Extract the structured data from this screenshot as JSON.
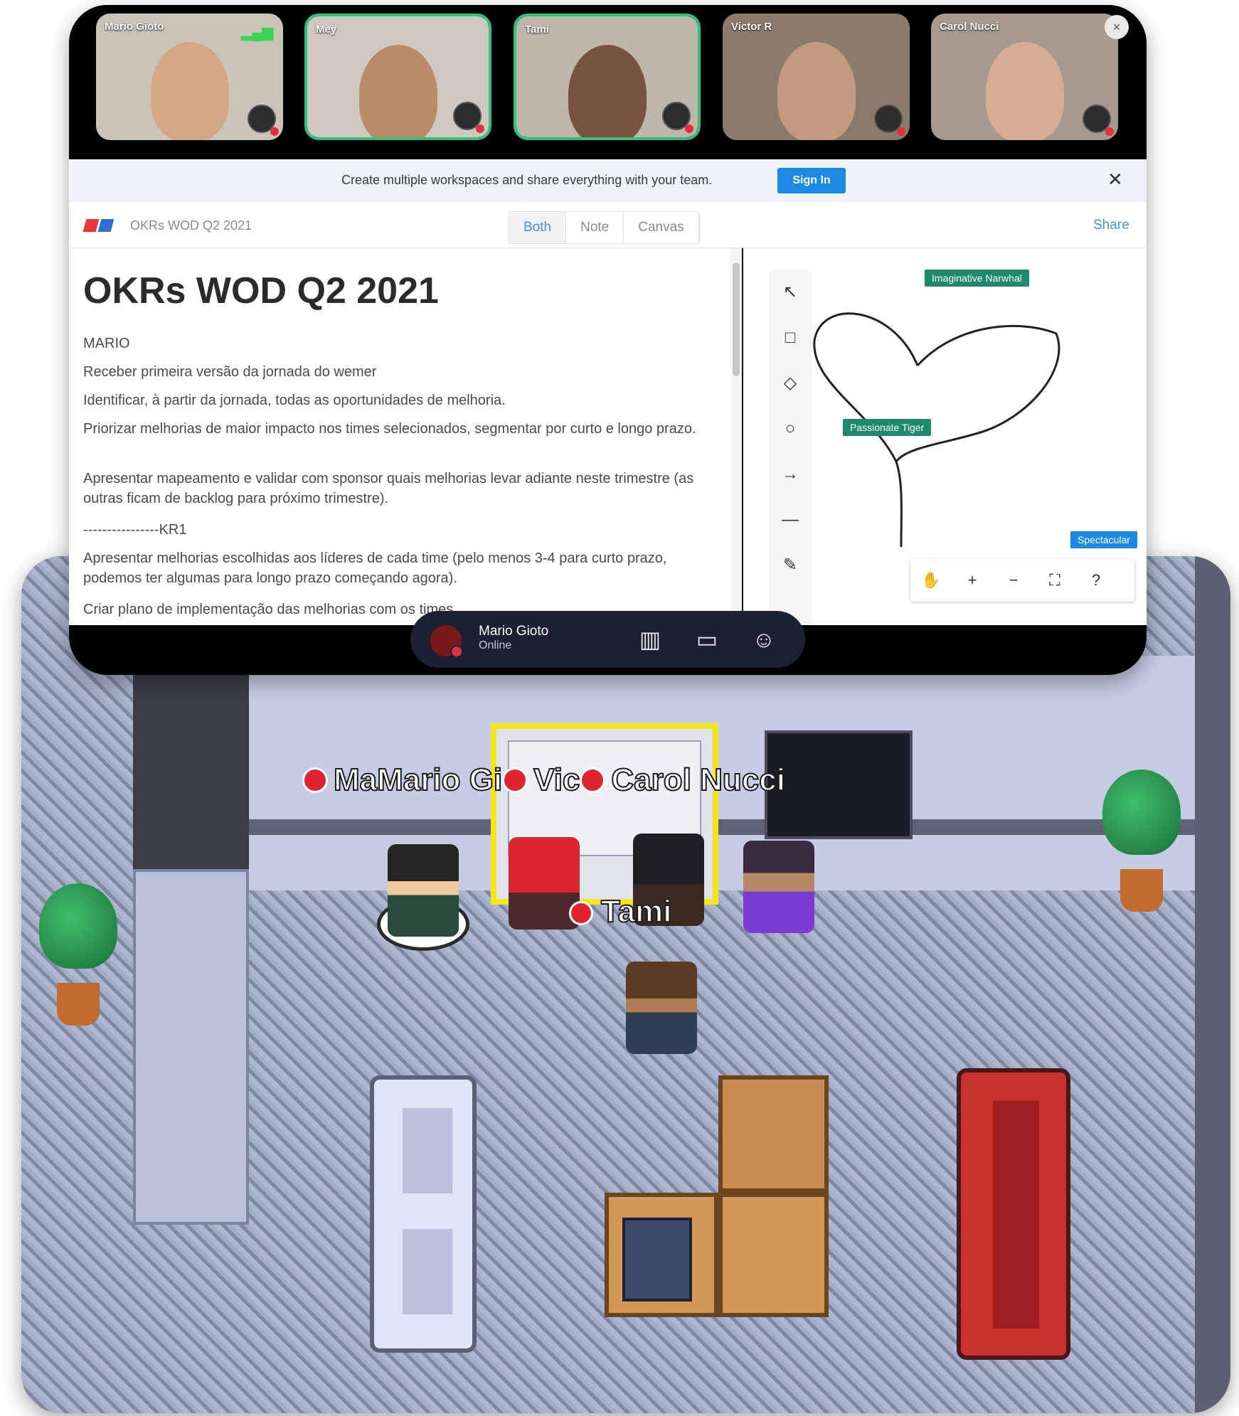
{
  "game": {
    "player_names": [
      "Ma",
      "Mario Gi",
      "Vic",
      "Carol Nucci"
    ],
    "tami_label": "Tami"
  },
  "video": {
    "participants": [
      {
        "name": "Mario Gioto",
        "bg": "#c9c3b8",
        "face": "#d4a887",
        "speaking": false
      },
      {
        "name": "Mey",
        "bg": "#cfc8bf",
        "face": "#b98b6b",
        "speaking": true
      },
      {
        "name": "Tami",
        "bg": "#bfb5ab",
        "face": "#7a5240",
        "speaking": true
      },
      {
        "name": "Victor R",
        "bg": "#8b7b6c",
        "face": "#c49a7e",
        "speaking": false
      },
      {
        "name": "Carol Nucci",
        "bg": "#a69a8e",
        "face": "#d6ad90",
        "speaking": false
      }
    ],
    "close_symbol": "×"
  },
  "banner": {
    "text": "Create multiple workspaces and share everything with your team.",
    "sign_in_label": "Sign In",
    "close_symbol": "✕"
  },
  "doc": {
    "title_small": "OKRs WOD Q2 2021",
    "tabs": [
      "Both",
      "Note",
      "Canvas"
    ],
    "active_tab": "Both",
    "share_label": "Share",
    "heading": "OKRs WOD Q2 2021",
    "lines": [
      "MARIO",
      "Receber primeira versão da jornada do wemer",
      "Identificar, à partir da jornada, todas as oportunidades de melhoria.",
      "Priorizar melhorias de maior impacto nos times selecionados, segmentar por curto e longo prazo.",
      "Apresentar mapeamento e validar com sponsor quais melhorias levar adiante neste trimestre (as outras ficam de backlog para próximo trimestre).",
      "----------------KR1",
      "Apresentar melhorias escolhidas aos líderes de cada time (pelo menos 3-4 para curto prazo, podemos ter algumas para longo prazo começando agora).",
      "Criar plano de implementação das melhorias com os times..."
    ]
  },
  "canvas": {
    "tools": [
      "select-icon",
      "rectangle-icon",
      "diamond-icon",
      "circle-icon",
      "arrow-icon",
      "line-icon",
      "pen-icon"
    ],
    "tool_glyphs": [
      "↖",
      "□",
      "◇",
      "○",
      "→",
      "—",
      "✎"
    ],
    "cursor_tags": [
      "Imaginative Narwhal",
      "Passionate Tiger",
      "Spectacular"
    ],
    "zoom_glyphs": [
      "✋",
      "+",
      "−",
      "⛶",
      "?"
    ]
  },
  "user_bar": {
    "name": "Mario Gioto",
    "status": "Online",
    "icons": [
      "map-icon",
      "screen-share-icon",
      "emoji-icon"
    ],
    "icon_glyphs": [
      "▥",
      "▭",
      "☺"
    ]
  },
  "colors": {
    "accent_blue": "#1e88e5",
    "speaking_green": "#2ec27e",
    "tag_green": "#1d8a6b",
    "mute_red": "#e23040"
  }
}
